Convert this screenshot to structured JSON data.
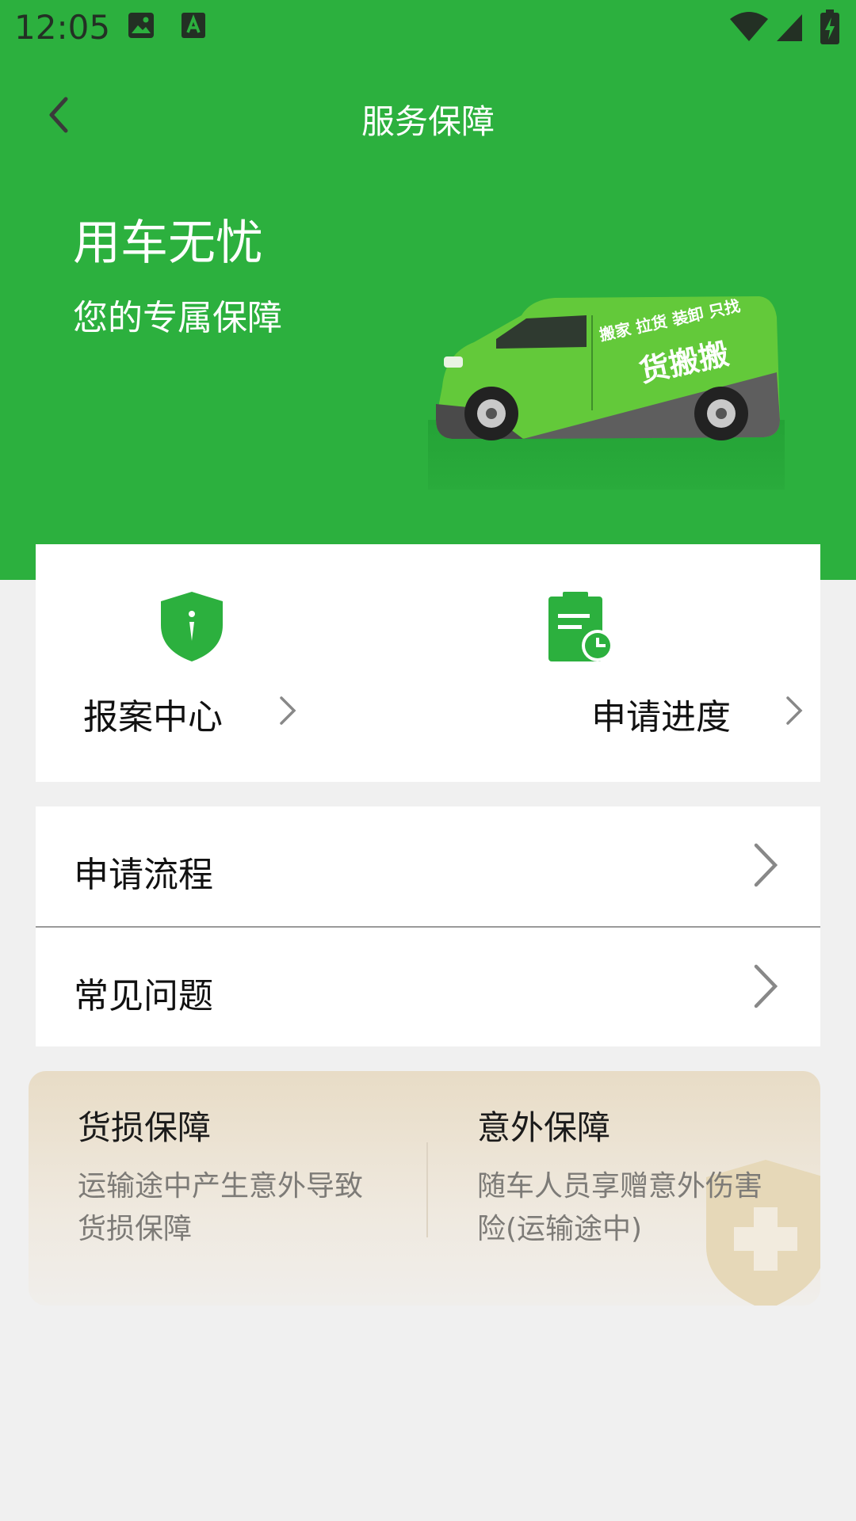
{
  "status_bar": {
    "time": "12:05"
  },
  "toolbar": {
    "title": "服务保障"
  },
  "hero": {
    "title": "用车无忧",
    "subtitle": "您的专属保障",
    "van_slogan": "搬家 拉货 装卸 只找",
    "van_brand": "货搬搬"
  },
  "actions": [
    {
      "label": "报案中心",
      "icon": "shield-info-icon"
    },
    {
      "label": "申请进度",
      "icon": "clipboard-clock-icon"
    }
  ],
  "list": [
    {
      "label": "申请流程"
    },
    {
      "label": "常见问题"
    }
  ],
  "guarantee": {
    "cargo": {
      "title": "货损保障",
      "desc_line1": "运输途中产生意外导致",
      "desc_line2": "货损保障"
    },
    "accident": {
      "title": "意外保障",
      "desc_line1": "随车人员享赠意外伤害",
      "desc_line2": "险(运输途中)"
    }
  },
  "colors": {
    "primary_green": "#2cb03e",
    "background": "#f0f0f0",
    "card_beige": "#e8dcc6"
  }
}
